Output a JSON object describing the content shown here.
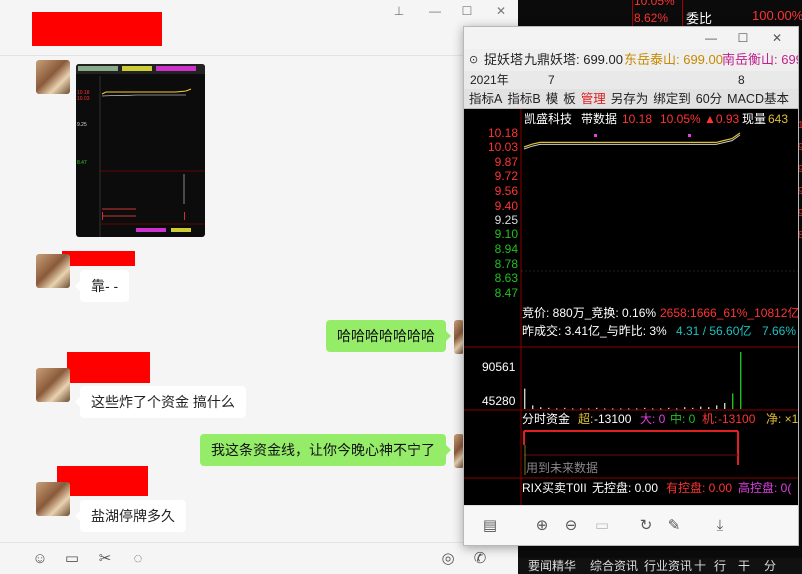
{
  "chat": {
    "messages": [
      {
        "side": "left",
        "type": "image"
      },
      {
        "side": "left",
        "type": "text",
        "text": "靠- -"
      },
      {
        "side": "right",
        "type": "text",
        "text": "哈哈哈哈哈哈哈"
      },
      {
        "side": "left",
        "type": "text",
        "text": "这些炸了个资金 搞什么"
      },
      {
        "side": "right",
        "type": "text",
        "text": "我这条资金线，让你今晚心神不宁了"
      },
      {
        "side": "left",
        "type": "text",
        "text": "盐湖停牌多久"
      }
    ],
    "toolbar_icons": [
      "emoji-icon",
      "folder-icon",
      "scissors-icon",
      "chat-bubble-icon",
      "video-icon",
      "phone-icon"
    ]
  },
  "bg_stock": {
    "top_pct": "10.05%",
    "top_pct2": "8.62%",
    "weibi_label": "委比",
    "weibi_value": "100.00%",
    "bottom_tabs": [
      "要闻精华",
      "综合资讯",
      "行业资讯",
      "十",
      "行",
      "干",
      "分"
    ]
  },
  "popup": {
    "window_controls": [
      "minimize",
      "maximize",
      "close"
    ],
    "quotes": {
      "prefix": "捉妖塔",
      "q1": "九鼎妖塔: 699.00",
      "q2": "东岳泰山: 699.00",
      "q3": "南岳衡山: 699."
    },
    "dates": {
      "year": "2021年",
      "d1": "7",
      "d2": "8"
    },
    "menu": [
      "指标A",
      "指标B",
      "模",
      "板",
      "管理",
      "另存为",
      "绑定到",
      "60分",
      "MACD基本"
    ],
    "menu_active": "管理",
    "footer_icons": [
      "layout-icon",
      "zoom-in-icon",
      "zoom-out-icon",
      "fit-icon",
      "rotate-icon",
      "edit-icon",
      "download-icon"
    ]
  },
  "chart_data": {
    "type": "line",
    "header": {
      "name": "凯盛科技",
      "label": "带数据",
      "price": "10.18",
      "change_pct": "10.05%",
      "change": "▲0.93",
      "volume_label": "现量",
      "volume": "643"
    },
    "y_ticks_red": [
      "10.18",
      "10.03",
      "9.87",
      "9.72",
      "9.56",
      "9.40"
    ],
    "y_tick_mid": "9.25",
    "y_ticks_green": [
      "9.10",
      "8.94",
      "8.78",
      "8.63",
      "8.47"
    ],
    "ylim": [
      8.47,
      10.18
    ],
    "price_series": [
      10.03,
      10.06,
      10.08,
      10.08,
      10.08,
      10.08,
      10.08,
      10.08,
      10.08,
      10.08,
      10.08,
      10.08,
      10.08,
      10.08,
      10.08,
      10.08,
      10.08,
      10.08,
      10.08,
      10.08,
      10.08,
      10.08,
      10.08,
      10.08,
      10.08,
      10.1,
      10.12,
      10.18
    ],
    "auction": {
      "text1": "竞价: 880万_竞换: 0.16%",
      "text2": "2658:1666_61%_10812亿",
      "text3": "昨成交: 3.41亿_与昨比: 3%",
      "text4": "4.31 / 56.60亿",
      "text5": "7.66%"
    },
    "volume_ticks": [
      "90561",
      "45280"
    ],
    "volume_series": [
      34,
      6,
      3,
      2,
      1,
      2,
      1,
      1,
      1,
      2,
      1,
      1,
      1,
      1,
      1,
      2,
      1,
      1,
      2,
      1,
      3,
      2,
      4,
      3,
      6,
      10,
      26,
      95
    ],
    "fund": {
      "title": "分时资金",
      "super_label": "超:",
      "super_value": "-13100",
      "big_label": "大: 0",
      "mid_label": "中: 0",
      "inst_label": "机:",
      "inst_value": "-13100",
      "net_label": "净: ×1",
      "note": "用到未来数据"
    },
    "rix": {
      "title": "RIX买卖T0II",
      "no_control": "无控盘: 0.00",
      "has_control": "有控盘: 0.00",
      "high_control": "高控盘: 0("
    }
  }
}
